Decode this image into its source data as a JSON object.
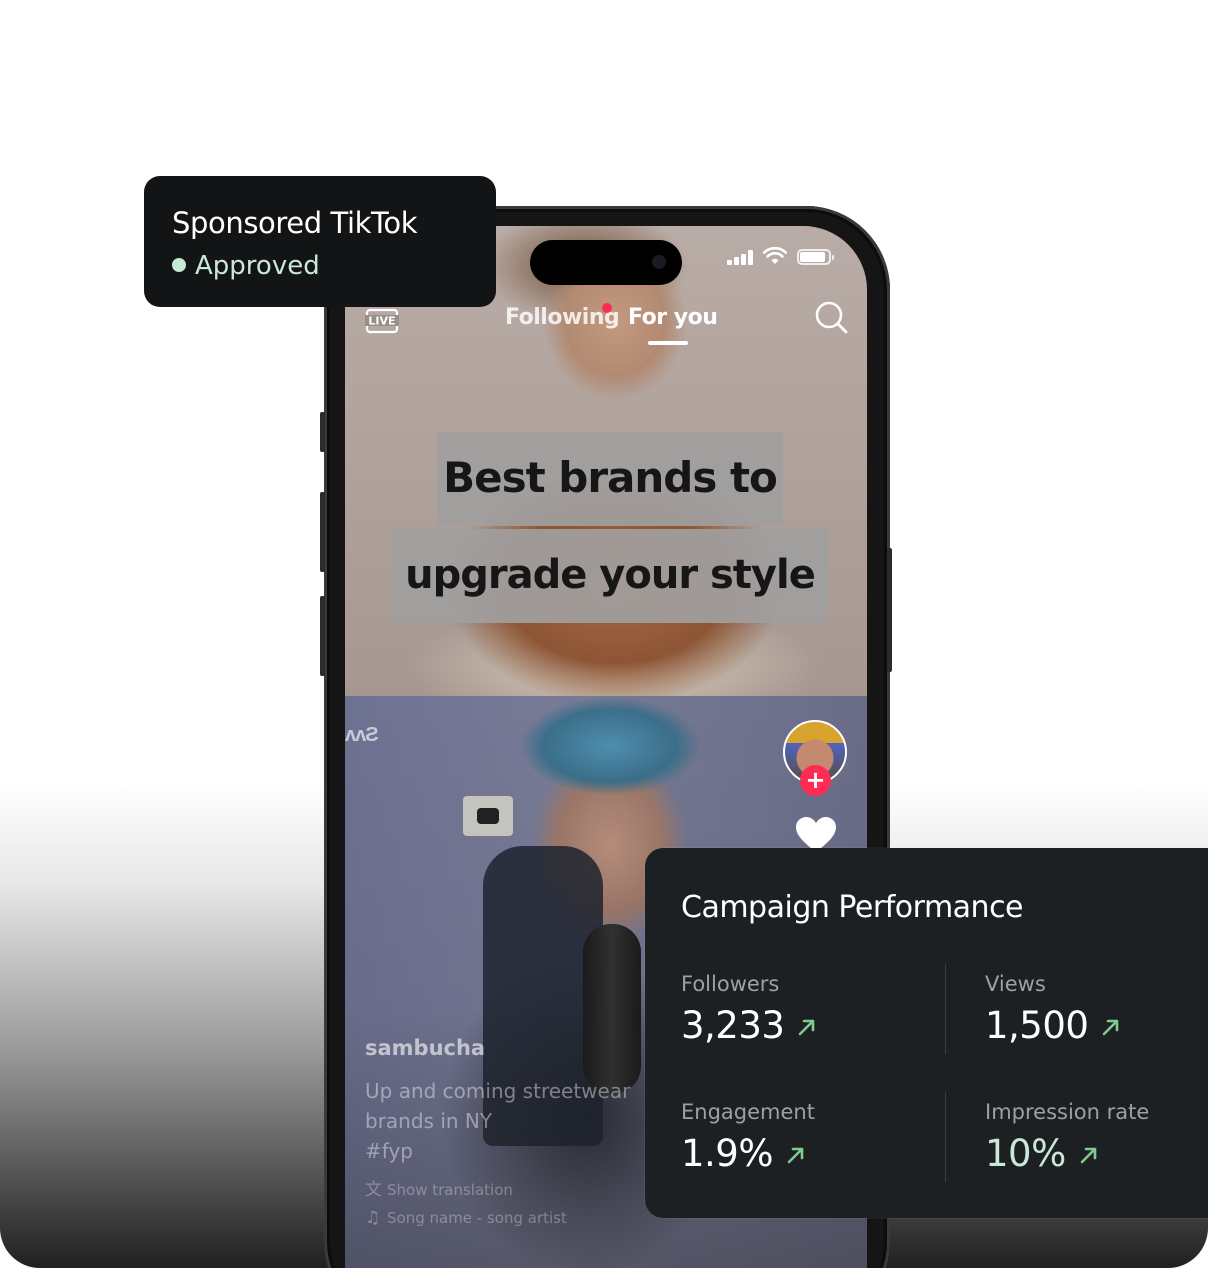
{
  "sponsored_card": {
    "title": "Sponsored TikTok",
    "status": "Approved",
    "status_color": "#c4ead5"
  },
  "phone": {
    "status_bar": {
      "icons": [
        "signal-icon",
        "wifi-icon",
        "battery-icon"
      ]
    },
    "top_nav": {
      "live_label": "LIVE",
      "tabs": [
        {
          "label": "Following",
          "active": false,
          "has_notification_dot": true
        },
        {
          "label": "For you",
          "active": true
        }
      ],
      "icons": [
        "live-icon",
        "search-icon"
      ]
    },
    "caption_overlay": {
      "line1": "Best brands to",
      "line2": "upgrade your style"
    },
    "right_rail": {
      "icons": [
        "avatar",
        "follow-plus-icon",
        "heart-icon"
      ],
      "accent_color": "#fe2c55"
    },
    "video_info": {
      "username": "sambucha",
      "description_line1": "Up and coming streetwear",
      "description_line2": "brands in NY",
      "hashtag": "#fyp",
      "translation": "Show translation",
      "song": "Song name - song artist",
      "icons": [
        "translate-icon",
        "music-note-icon"
      ]
    }
  },
  "campaign_performance": {
    "title": "Campaign Performance",
    "metrics": [
      {
        "label": "Followers",
        "value": "3,233",
        "trend": "up"
      },
      {
        "label": "Views",
        "value": "1,500",
        "trend": "up"
      },
      {
        "label": "Engagement",
        "value": "1.9%",
        "trend": "up"
      },
      {
        "label": "Impression rate",
        "value": "10%",
        "trend": "up",
        "highlight": true
      }
    ],
    "trend_color": "#7ecb8f",
    "highlight_color": "#c9e9d8"
  }
}
